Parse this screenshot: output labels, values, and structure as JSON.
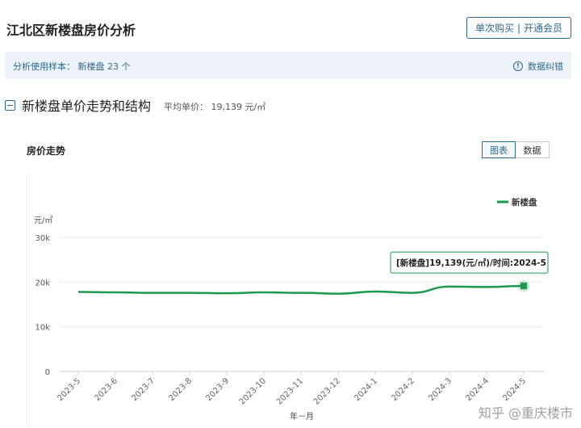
{
  "header": {
    "title": "江北区新楼盘房价分析",
    "buy_once_label": "单次购买",
    "separator": "|",
    "member_label": "开通会员"
  },
  "info_bar": {
    "sample_label": "分析使用样本：  新楼盘 23 个",
    "feedback_label": "数据纠错",
    "feedback_icon": "info-circle-icon"
  },
  "section": {
    "title": "新楼盘单价走势和结构",
    "avg_price": "平均单价：  19,139 元/㎡"
  },
  "chart_panel": {
    "title": "房价走势",
    "tab_chart": "图表",
    "tab_data": "数据"
  },
  "chart_data": {
    "type": "line",
    "ylabel": "元/㎡",
    "xlabel": "年－月",
    "ylim": [
      0,
      30000
    ],
    "y_ticks": [
      "0",
      "10k",
      "20k",
      "30k"
    ],
    "y_tick_values": [
      0,
      10000,
      20000,
      30000
    ],
    "categories": [
      "2023-5",
      "2023-6",
      "2023-7",
      "2023-8",
      "2023-9",
      "2023-10",
      "2023-11",
      "2023-12",
      "2024-1",
      "2024-2",
      "2024-3",
      "2024-4",
      "2024-5"
    ],
    "series": [
      {
        "name": "新楼盘",
        "color": "#1a9a4a",
        "values": [
          17800,
          17700,
          17600,
          17600,
          17500,
          17700,
          17600,
          17400,
          17900,
          17600,
          19000,
          18900,
          19139
        ]
      }
    ],
    "legend_position": "top-right",
    "grid": true,
    "tooltip": "[新楼盘]19,139(元/㎡)/时间:2024-5"
  },
  "watermark": "知乎 @重庆楼市"
}
